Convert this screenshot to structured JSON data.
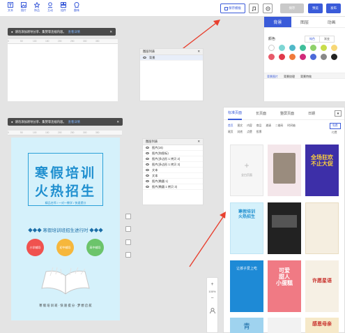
{
  "toolbar": {
    "tools": [
      {
        "label": "文本",
        "icon": "text-icon"
      },
      {
        "label": "图片",
        "icon": "image-icon"
      },
      {
        "label": "饰品",
        "icon": "decoration-icon"
      },
      {
        "label": "互动",
        "icon": "interaction-icon"
      },
      {
        "label": "组件",
        "icon": "component-icon"
      },
      {
        "label": "趣味",
        "icon": "fun-icon"
      }
    ],
    "save_template": "保存模板",
    "disabled_button": "保存",
    "preview": "预览",
    "publish": "发布"
  },
  "right_panel": {
    "tabs": [
      "背景",
      "图层",
      "动画"
    ],
    "color_label": "颜色",
    "color_tabs": [
      "纯色",
      "渐变"
    ],
    "swatches_row1": [
      "#ffffff",
      "#7ed6d4",
      "#4fb8c8",
      "#3fbf9a",
      "#8fd16a",
      "#c8dd4a",
      "#f7d775"
    ],
    "swatches_row2": [
      "#e85a6a",
      "#e0394a",
      "#f07a3a",
      "#d12a7a",
      "#4c6ad9",
      "#888888",
      "#222222"
    ],
    "bg_tabs": [
      "背景图片",
      "背景纹理",
      "背景特效"
    ]
  },
  "notice1": {
    "text": "请勿添加诱导分享、集赞等违规内容。",
    "link": "查看详情"
  },
  "notice2": {
    "text": "请勿添加诱导分享、集赞等违规内容。",
    "link": "查看详情"
  },
  "ruler": [
    "0",
    "50",
    "100",
    "150",
    "200",
    "250",
    "300",
    "350",
    "400"
  ],
  "layer1": {
    "title": "图层列表",
    "items": [
      "背景"
    ]
  },
  "layer2": {
    "title": "图层列表",
    "items": [
      "图片(16)",
      "图片(和图标)",
      "图片(多边形 1 拷贝 2)",
      "图片(多边形 1 拷贝 3)",
      "文本",
      "文本",
      "图片(椭圆 1)",
      "图片(椭圆 1 拷贝 3)"
    ]
  },
  "poster": {
    "title1": "寒假培训",
    "title2": "火热招生",
    "subtitle": "精品名师 / 一对一教学 / 快速提分",
    "banner": "◆◆◆ 寒假培训班招生进行时 ◆◆◆",
    "circles": [
      {
        "label": "小学辅导",
        "color": "#f0524f"
      },
      {
        "label": "初中辅导",
        "color": "#f6b73c"
      },
      {
        "label": "高中辅导",
        "color": "#6cc46b"
      }
    ],
    "footer": "寒 假 培 训 班 · 快 速 提 分 · 梦 想 启 航"
  },
  "zoom": {
    "plus": "+",
    "level": "100%",
    "minus": "−"
  },
  "templates": {
    "tabs": [
      "标准页面",
      "长页面",
      "整屏页面",
      "日期"
    ],
    "row1": [
      "首页",
      "图文",
      "内容",
      "商品",
      "邀请",
      "二维码",
      "时间轴"
    ],
    "row2": [
      "尾页",
      "封底",
      "点赞",
      "投票"
    ],
    "badges": [
      "免费",
      "付费"
    ],
    "blank_label": "全白页面",
    "cards": [
      {
        "text": "",
        "bg": "#f4e6ea"
      },
      {
        "text": "全场狂欢\n不止大促",
        "bg": "#3d2fa8"
      },
      {
        "text": "寒假培训\n火热招生",
        "bg": "#d5f1fb"
      },
      {
        "text": "",
        "bg": "#222222"
      },
      {
        "text": "",
        "bg": "#f5eee0"
      },
      {
        "text": "让孩子爱上吃",
        "bg": "#1e8ad6"
      },
      {
        "text": "可爱\n甜人\n小蛋糕",
        "bg": "#f07a84"
      },
      {
        "text": "许愿星语",
        "bg": "#f6f0e4"
      },
      {
        "text": "青",
        "bg": "#9fd3ef"
      },
      {
        "text": "",
        "bg": "#f2f2f2"
      },
      {
        "text": "感恩母亲",
        "bg": "#f6e9c9"
      }
    ]
  },
  "colors": {
    "accent": "#3a5bd9",
    "arrow": "#e8402f"
  }
}
